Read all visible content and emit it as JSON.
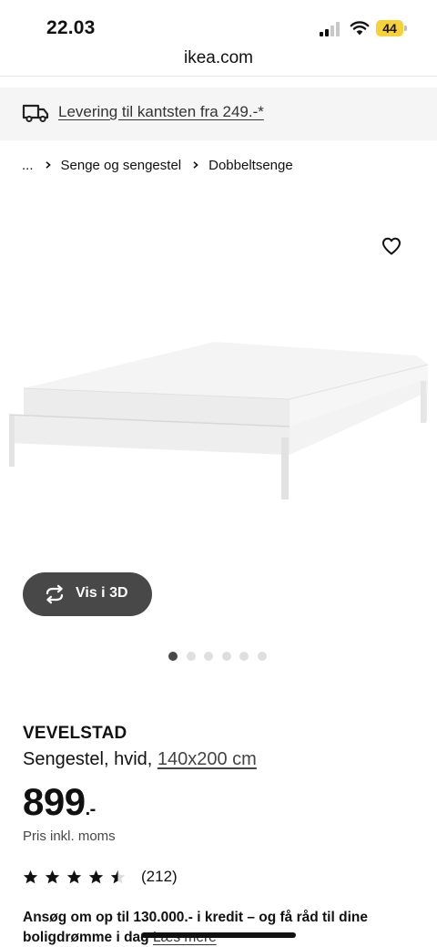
{
  "status_bar": {
    "time": "22.03",
    "battery_level": "44",
    "battery_color": "#f6d23a"
  },
  "browser": {
    "url": "ikea.com"
  },
  "delivery_banner": {
    "icon": "truck-icon",
    "text": "Levering til kantsten fra 249.-*"
  },
  "breadcrumb": {
    "items": [
      "...",
      "Senge og sengestel",
      "Dobbeltsenge"
    ]
  },
  "gallery": {
    "favorite_icon": "heart-outline-icon",
    "view_3d_label": "Vis i 3D",
    "view_3d_icon": "rotate-3d-icon",
    "dot_count": 6,
    "active_dot": 1
  },
  "product": {
    "name": "VEVELSTAD",
    "description": "Sengestel, hvid,",
    "size": "140x200 cm",
    "price": "899",
    "price_suffix": ".-",
    "price_note": "Pris inkl. moms",
    "rating_value": 4.5,
    "rating_max": 5,
    "rating_count": "(212)",
    "credit_text": "Ansøg om op til 130.000.- i kredit – og få råd til dine boligdrømme i dag",
    "read_more": "Læs mere"
  },
  "colors": {
    "dark_button": "#484848",
    "banner_bg": "#f5f5f5",
    "dot_inactive": "#dfdfdf"
  }
}
